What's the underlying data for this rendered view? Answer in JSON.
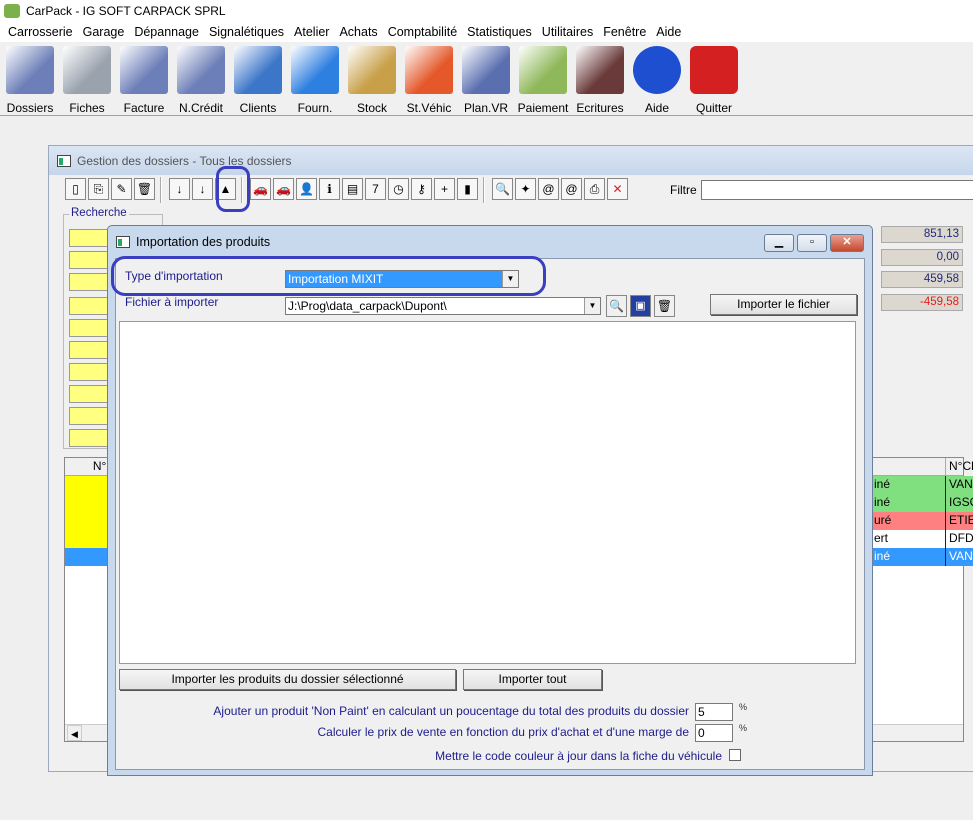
{
  "app": {
    "title": "CarPack - IG SOFT CARPACK SPRL"
  },
  "menu": [
    "Carrosserie",
    "Garage",
    "Dépannage",
    "Signalétiques",
    "Atelier",
    "Achats",
    "Comptabilité",
    "Statistiques",
    "Utilitaires",
    "Fenêtre",
    "Aide"
  ],
  "toolbar": [
    {
      "label": "Dossiers",
      "icon": "folder-documents-icon",
      "color": "#6c7fb8"
    },
    {
      "label": "Fiches",
      "icon": "tools-icon",
      "color": "#9aa3ad"
    },
    {
      "label": "Facture",
      "icon": "invoice-add-icon",
      "color": "#6c7fb8"
    },
    {
      "label": "N.Crédit",
      "icon": "credit-note-icon",
      "color": "#6c7fb8"
    },
    {
      "label": "Clients",
      "icon": "client-person-icon",
      "color": "#3b76c9"
    },
    {
      "label": "Fourn.",
      "icon": "truck-icon",
      "color": "#2d7fe0"
    },
    {
      "label": "Stock",
      "icon": "boxes-icon",
      "color": "#c9a04a"
    },
    {
      "label": "St.Véhic",
      "icon": "cars-icon",
      "color": "#e4582a"
    },
    {
      "label": "Plan.VR",
      "icon": "car-keys-icon",
      "color": "#5a6fb0"
    },
    {
      "label": "Paiement",
      "icon": "payment-money-icon",
      "color": "#8fb85a"
    },
    {
      "label": "Ecritures",
      "icon": "books-icon",
      "color": "#6a3a3a"
    },
    {
      "label": "Aide",
      "icon": "help-icon",
      "color": "#1d4fd0"
    },
    {
      "label": "Quitter",
      "icon": "power-quit-icon",
      "color": "#d42020"
    }
  ],
  "gestion": {
    "title": "Gestion des dossiers - Tous les dossiers",
    "filter_label": "Filtre",
    "filter_value": "",
    "search_group": "Recherche",
    "totals": [
      "851,13",
      "0,00",
      "459,58",
      "-459,58"
    ],
    "grid": {
      "col_first": "N°D",
      "col_client": "N°Cli",
      "rows": [
        {
          "status": "iné",
          "client": "VANH",
          "color": "#80e080"
        },
        {
          "status": "iné",
          "client": "IGSO",
          "color": "#80e080"
        },
        {
          "status": "uré",
          "client": "ETIEN",
          "color": "#ff8080"
        },
        {
          "status": "ert",
          "client": "DFDS",
          "color": "#ffffff"
        },
        {
          "status": "iné",
          "client": "VANT",
          "color": "#3399ff"
        }
      ]
    }
  },
  "dialog": {
    "title": "Importation des produits",
    "type_label": "Type d'importation",
    "type_value": "Importation MIXIT",
    "file_label": "Fichier à importer",
    "file_value": "J:\\Prog\\data_carpack\\Dupont\\",
    "import_file_button": "Importer le fichier",
    "import_selected_button": "Importer les produits du dossier sélectionné",
    "import_all_button": "Importer tout",
    "non_paint_label": "Ajouter un produit 'Non Paint' en calculant un poucentage du total des produits du dossier",
    "non_paint_value": "5",
    "margin_label": "Calculer le prix de vente en fonction du prix d'achat et d'une marge de",
    "margin_value": "0",
    "percent": "%",
    "color_code_label": "Mettre le code couleur à jour dans la fiche du véhicule",
    "color_code_checked": false
  },
  "colors": {
    "highlight": "#3a3fc0",
    "selection": "#3399ff",
    "label_text": "#1c1c8c",
    "negative": "#e02020"
  }
}
